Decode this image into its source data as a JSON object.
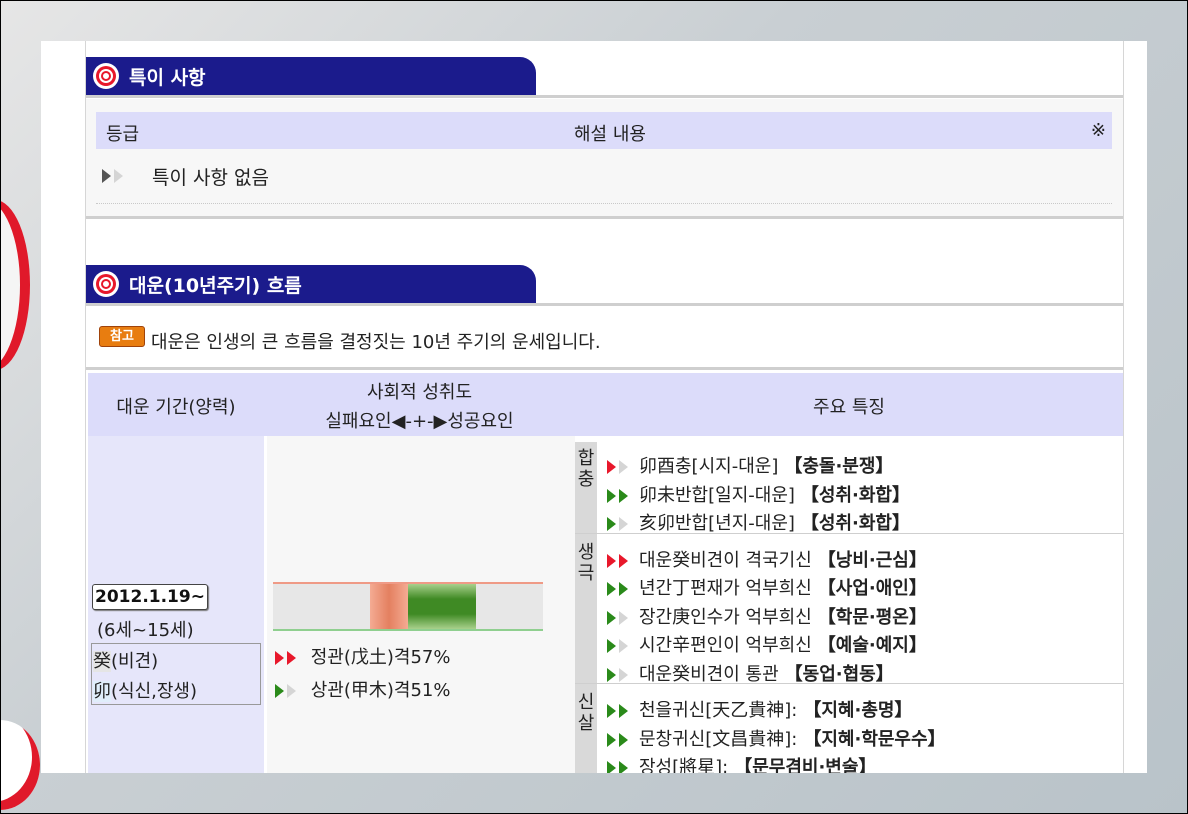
{
  "section1": {
    "title": "특이 사항",
    "header": {
      "grade": "등급",
      "content": "해설 내용",
      "mark": "※"
    },
    "row": {
      "text": "특이 사항 없음"
    }
  },
  "section2": {
    "title": "대운(10년주기) 흐름",
    "note_badge": "참고",
    "note_text": "대운은 인생의 큰 흐름을 결정짓는 10년 주기의 운세입니다.",
    "table": {
      "col1_header": "대운 기간(양력)",
      "col2_header_line1": "사회적 성취도",
      "col2_header_line2": "실패요인◀-+-▶성공요인",
      "col3_header": "주요 특징",
      "period": {
        "date": "2012.1.19~",
        "age": "(6세~15세)",
        "line1_char": "癸",
        "line1_text": "(비견)",
        "line2_char": "卯",
        "line2_text": "(식신,장생)"
      },
      "achievement": {
        "failure_level": 0.14,
        "success_level": 0.25,
        "items": [
          {
            "text": "정관(戊土)격57%",
            "color": "#e8182b"
          },
          {
            "text": "상관(甲木)격51%",
            "color": "#2a8a1a"
          }
        ]
      },
      "features": [
        {
          "category": "합충",
          "items": [
            {
              "text": "卯酉충[시지-대운]",
              "tag": "【충돌·분쟁】",
              "color": "#e8182b",
              "level": 1
            },
            {
              "text": "卯未반합[일지-대운]",
              "tag": "【성취·화합】",
              "color": "#2a8a1a",
              "level": 2
            },
            {
              "text": "亥卯반합[년지-대운]",
              "tag": "【성취·화합】",
              "color": "#2a8a1a",
              "level": 1
            }
          ]
        },
        {
          "category": "생극",
          "items": [
            {
              "text": "대운癸비견이 격국기신",
              "tag": "【낭비·근심】",
              "color": "#e8182b",
              "level": 2
            },
            {
              "text": "년간丁편재가 억부희신",
              "tag": "【사업·애인】",
              "color": "#2a8a1a",
              "level": 2
            },
            {
              "text": "장간庚인수가 억부희신",
              "tag": "【학문·평온】",
              "color": "#2a8a1a",
              "level": 1
            },
            {
              "text": "시간辛편인이 억부희신",
              "tag": "【예술·예지】",
              "color": "#2a8a1a",
              "level": 1
            },
            {
              "text": "대운癸비견이 통관",
              "tag": "【동업·협동】",
              "color": "#2a8a1a",
              "level": 1
            }
          ]
        },
        {
          "category": "신살",
          "items": [
            {
              "text": "천을귀신[天乙貴神]:",
              "tag": "【지혜·총명】",
              "color": "#2a8a1a",
              "level": 2
            },
            {
              "text": "문창귀신[文昌貴神]:",
              "tag": "【지혜·학문우수】",
              "color": "#2a8a1a",
              "level": 2
            },
            {
              "text": "장성[將星]:",
              "tag": "【문무겸비·변술】",
              "color": "#2a8a1a",
              "level": 2
            }
          ]
        }
      ]
    }
  }
}
